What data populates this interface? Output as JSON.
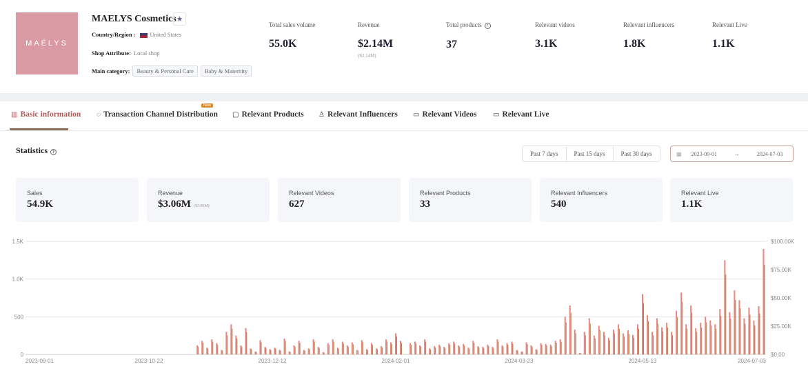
{
  "shop": {
    "logo_text": "MAËLYS",
    "name": "MAELYS Cosmetics",
    "country_label": "Country/Region :",
    "country": "United States",
    "attribute_label": "Shop Attribute:",
    "attribute": "Local shop",
    "category_label": "Main category:",
    "categories": [
      "Beauty & Personal Care",
      "Baby & Maternity"
    ]
  },
  "kpis": [
    {
      "label": "Total sales volume",
      "value": "55.0K"
    },
    {
      "label": "Revenue",
      "value": "$2.14M",
      "sub": "($2.14M)"
    },
    {
      "label": "Total products",
      "value": "37"
    },
    {
      "label": "Relevant videos",
      "value": "3.1K"
    },
    {
      "label": "Relevant influencers",
      "value": "1.8K"
    },
    {
      "label": "Relevant Live",
      "value": "1.1K"
    }
  ],
  "tabs": [
    {
      "label": "Basic information",
      "icon": "bar-chart-icon",
      "active": true
    },
    {
      "label": "Transaction Channel Distribution",
      "icon": "distribution-icon",
      "badge": "New"
    },
    {
      "label": "Relevant Products",
      "icon": "bag-icon"
    },
    {
      "label": "Relevant Influencers",
      "icon": "user-icon"
    },
    {
      "label": "Relevant Videos",
      "icon": "video-icon"
    },
    {
      "label": "Relevant Live",
      "icon": "live-icon"
    }
  ],
  "statistics": {
    "title": "Statistics",
    "ranges": [
      "Past 7 days",
      "Past 15 days",
      "Past 30 days"
    ],
    "date_from": "2023-09-01",
    "date_to": "2024-07-03",
    "date_sep": "→",
    "cards": [
      {
        "label": "Sales",
        "value": "54.9K"
      },
      {
        "label": "Revenue",
        "value": "$3.06M",
        "sub": "($3.06M)"
      },
      {
        "label": "Relevant Videos",
        "value": "627"
      },
      {
        "label": "Relevant Products",
        "value": "33"
      },
      {
        "label": "Relevant Influencers",
        "value": "540"
      },
      {
        "label": "Relevant Live",
        "value": "1.1K"
      }
    ]
  },
  "colors": {
    "accent": "#b35a5a",
    "bar": "#e8867e",
    "bar_dark": "#a8825a"
  },
  "chart_data": {
    "type": "bar",
    "xlim": [
      "2023-09-01",
      "2024-07-03"
    ],
    "ylim": [
      0,
      1500
    ],
    "y2lim": [
      0,
      100000
    ],
    "grid": true,
    "x_ticks": [
      "2023-09-01",
      "2023-10-22",
      "2023-12-12",
      "2024-02-01",
      "2024-03-23",
      "2024-05-13",
      "2024-07-03"
    ],
    "y_ticks": [
      "0",
      "500",
      "1.0K",
      "1.5K"
    ],
    "y2_ticks": [
      "$0.00",
      "$25.00K",
      "$50.00K",
      "$75.00K",
      "$100.00K"
    ],
    "dates": [
      "2023-11-11",
      "2023-11-13",
      "2023-11-15",
      "2023-11-17",
      "2023-11-19",
      "2023-11-21",
      "2023-11-23",
      "2023-11-25",
      "2023-11-27",
      "2023-11-29",
      "2023-12-01",
      "2023-12-03",
      "2023-12-05",
      "2023-12-07",
      "2023-12-09",
      "2023-12-11",
      "2023-12-13",
      "2023-12-15",
      "2023-12-17",
      "2023-12-19",
      "2023-12-21",
      "2023-12-23",
      "2023-12-25",
      "2023-12-27",
      "2023-12-29",
      "2023-12-31",
      "2024-01-02",
      "2024-01-04",
      "2024-01-06",
      "2024-01-08",
      "2024-01-10",
      "2024-01-12",
      "2024-01-14",
      "2024-01-16",
      "2024-01-18",
      "2024-01-20",
      "2024-01-22",
      "2024-01-24",
      "2024-01-26",
      "2024-01-28",
      "2024-01-30",
      "2024-02-01",
      "2024-02-03",
      "2024-02-05",
      "2024-02-07",
      "2024-02-09",
      "2024-02-11",
      "2024-02-13",
      "2024-02-15",
      "2024-02-17",
      "2024-02-19",
      "2024-02-21",
      "2024-02-23",
      "2024-02-25",
      "2024-02-27",
      "2024-02-29",
      "2024-03-02",
      "2024-03-04",
      "2024-03-06",
      "2024-03-08",
      "2024-03-10",
      "2024-03-12",
      "2024-03-14",
      "2024-03-16",
      "2024-03-18",
      "2024-03-20",
      "2024-03-22",
      "2024-03-24",
      "2024-03-26",
      "2024-03-28",
      "2024-03-30",
      "2024-04-01",
      "2024-04-03",
      "2024-04-05",
      "2024-04-07",
      "2024-04-09",
      "2024-04-11",
      "2024-04-13",
      "2024-04-15",
      "2024-04-17",
      "2024-04-19",
      "2024-04-21",
      "2024-04-23",
      "2024-04-25",
      "2024-04-27",
      "2024-04-29",
      "2024-05-01",
      "2024-05-03",
      "2024-05-05",
      "2024-05-07",
      "2024-05-09",
      "2024-05-11",
      "2024-05-13",
      "2024-05-15",
      "2024-05-17",
      "2024-05-19",
      "2024-05-21",
      "2024-05-23",
      "2024-05-25",
      "2024-05-27",
      "2024-05-29",
      "2024-05-31",
      "2024-06-02",
      "2024-06-04",
      "2024-06-06",
      "2024-06-08",
      "2024-06-10",
      "2024-06-12",
      "2024-06-14",
      "2024-06-16",
      "2024-06-18",
      "2024-06-20",
      "2024-06-22",
      "2024-06-24",
      "2024-06-26",
      "2024-06-28",
      "2024-06-30",
      "2024-07-02"
    ],
    "values": [
      120,
      180,
      90,
      200,
      150,
      60,
      300,
      400,
      250,
      120,
      350,
      80,
      40,
      190,
      100,
      70,
      90,
      60,
      210,
      40,
      120,
      180,
      60,
      80,
      200,
      100,
      30,
      150,
      200,
      90,
      170,
      120,
      160,
      60,
      190,
      70,
      150,
      80,
      110,
      200,
      160,
      280,
      180,
      0,
      150,
      170,
      120,
      200,
      80,
      110,
      130,
      100,
      150,
      170,
      120,
      140,
      90,
      180,
      110,
      100,
      130,
      100,
      200,
      120,
      150,
      170,
      60,
      40,
      160,
      120,
      70,
      150,
      140,
      130,
      180,
      200,
      500,
      650,
      330,
      20,
      300,
      480,
      250,
      380,
      300,
      220,
      330,
      400,
      280,
      320,
      260,
      400,
      800,
      520,
      300,
      480,
      360,
      420,
      300,
      580,
      820,
      400,
      650,
      350,
      420,
      500,
      450,
      400,
      600,
      1250,
      560,
      850,
      720,
      480,
      620,
      450,
      640,
      1400
    ]
  }
}
